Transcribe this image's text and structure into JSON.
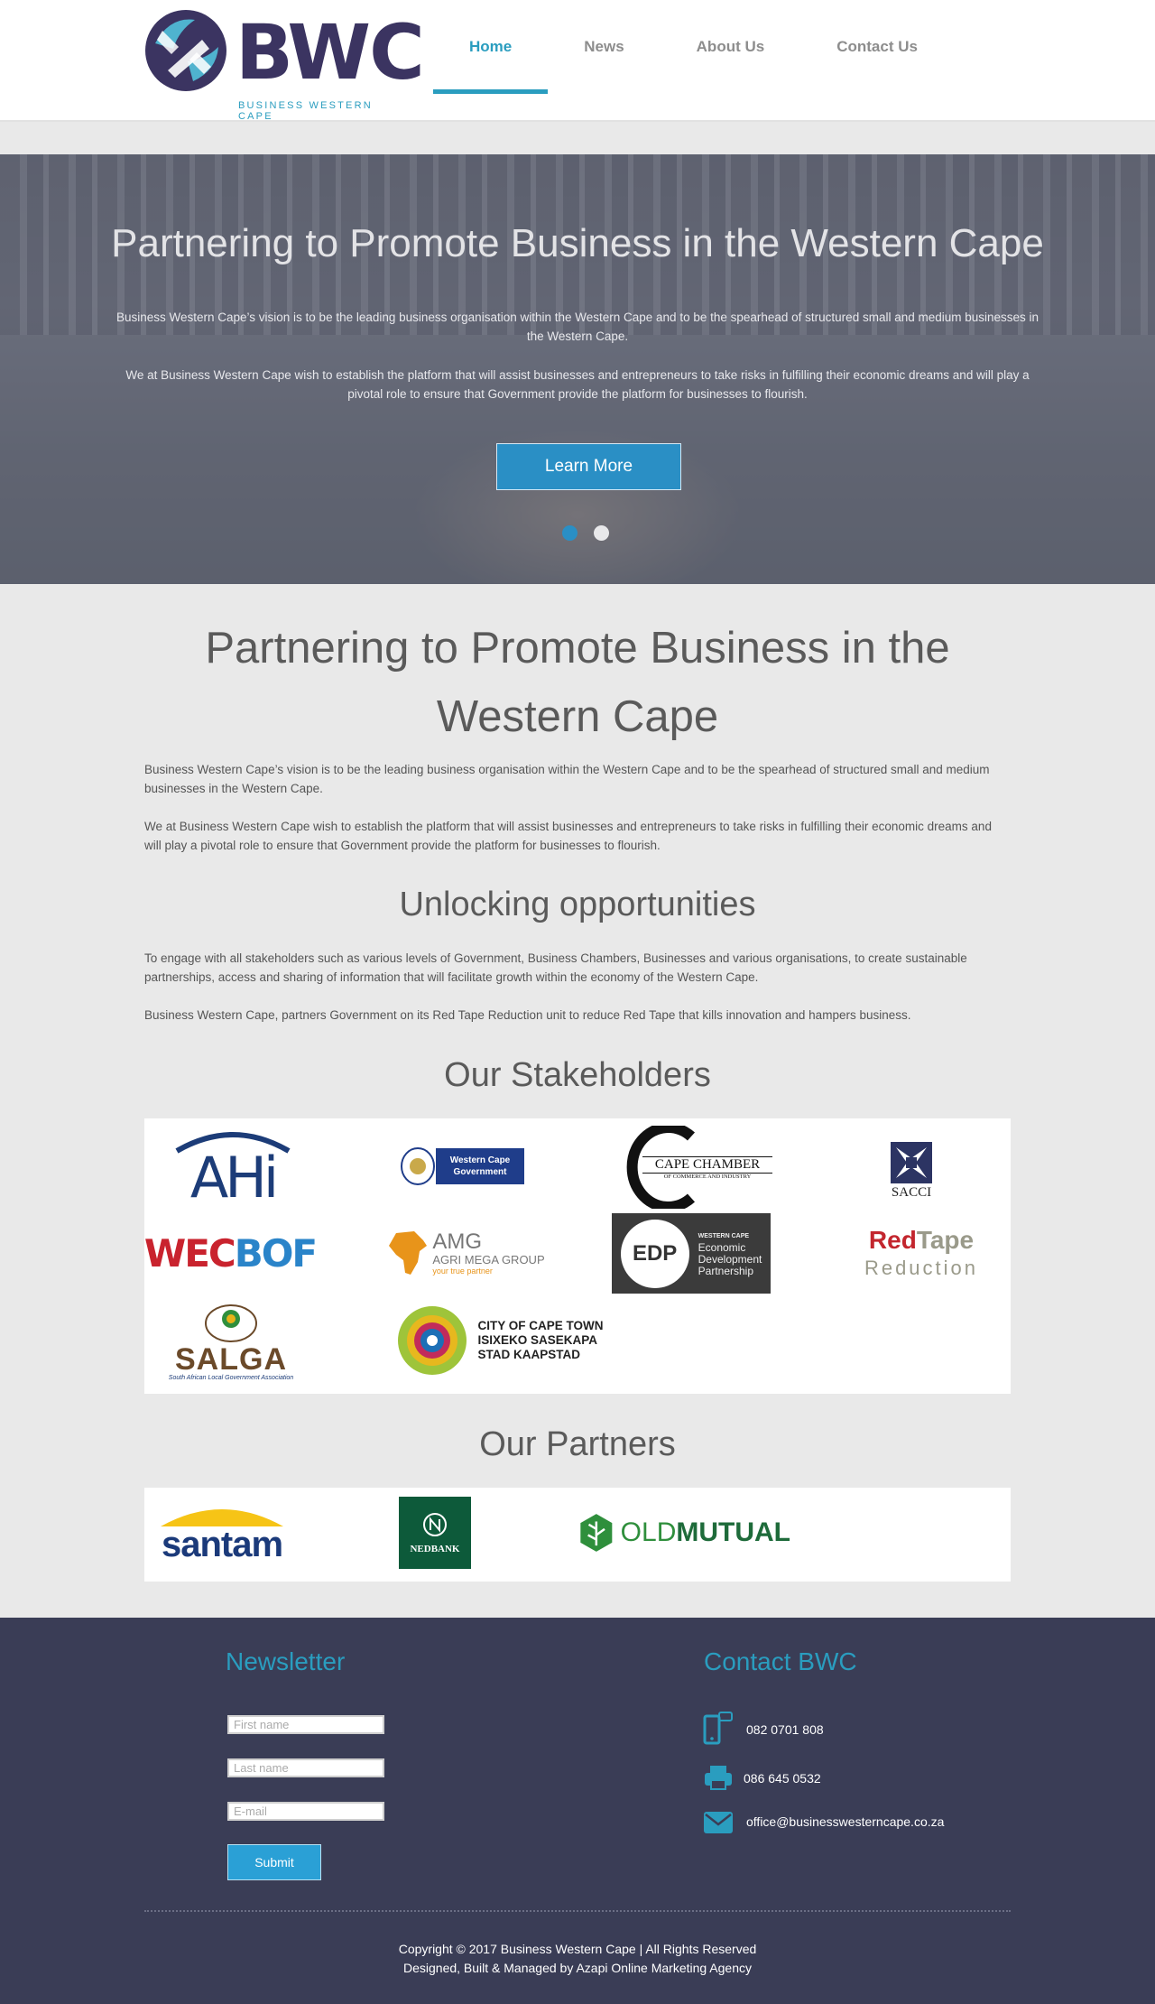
{
  "header": {
    "logo_text": "BWC",
    "logo_tagline": "BUSINESS WESTERN CAPE",
    "nav": [
      {
        "label": "Home",
        "active": true
      },
      {
        "label": "News",
        "active": false
      },
      {
        "label": "About Us",
        "active": false
      },
      {
        "label": "Contact Us",
        "active": false
      }
    ]
  },
  "hero": {
    "title": "Partnering to Promote Business in the Western Cape",
    "paragraph1": "Business Western Cape’s vision is to be the leading business organisation within the Western Cape and to be the spearhead of structured small and medium businesses in the Western Cape.",
    "paragraph2": "We at Business Western Cape wish to establish the platform that will assist businesses and entrepreneurs to take risks in fulfilling their economic dreams and will play a pivotal role to ensure that Government provide the platform for businesses to flourish.",
    "button_label": "Learn More",
    "slides": 2,
    "active_slide": 1
  },
  "intro": {
    "title": "Partnering to Promote Business in the Western Cape",
    "paragraph1": "Business Western Cape’s vision is to be the leading business organisation within the Western Cape and to be the spearhead of structured small and medium businesses in the Western Cape.",
    "paragraph2": "We at Business Western Cape wish to establish the platform that will assist businesses and entrepreneurs to take risks in fulfilling their economic dreams and will play a pivotal role to ensure that Government provide the platform for businesses to flourish."
  },
  "opportunities": {
    "title": "Unlocking opportunities",
    "paragraph1": "To engage with all stakeholders such as various levels of Government, Business Chambers, Businesses and various organisations, to create sustainable partnerships, access and sharing of information that will facilitate growth within the economy of the Western Cape.",
    "paragraph2": "Business Western Cape, partners Government on its Red Tape Reduction unit to reduce Red Tape that kills innovation and hampers business."
  },
  "stakeholders": {
    "title": "Our Stakeholders",
    "logos": {
      "ahi": "AHi",
      "wcg": "Western Cape Government",
      "cape_chamber": "CAPE CHAMBER",
      "cape_chamber_sub": "OF COMMERCE AND INDUSTRY",
      "sacci": "SACCI",
      "wecbof_a": "WEC",
      "wecbof_b": "BOF",
      "amg": "AMG",
      "amg_sub": "AGRI MEGA GROUP",
      "amg_tag": "your true partner",
      "edp": "EDP",
      "edp_l1": "WESTERN CAPE",
      "edp_l2": "Economic",
      "edp_l3": "Development",
      "edp_l4": "Partnership",
      "redtape_a": "Red",
      "redtape_b": "Tape",
      "redtape_c": "Reduction",
      "salga": "SALGA",
      "salga_sub": "South African Local Government Association",
      "cct_1": "CITY OF CAPE TOWN",
      "cct_2": "ISIXEKO SASEKAPA",
      "cct_3": "STAD KAAPSTAD"
    }
  },
  "partners": {
    "title": "Our Partners",
    "logos": {
      "santam": "santam",
      "nedbank": "NEDBANK",
      "oldmutual_a": "OLD",
      "oldmutual_b": "MUTUAL"
    }
  },
  "footer": {
    "newsletter_title": "Newsletter",
    "first_name_placeholder": "First name",
    "last_name_placeholder": "Last name",
    "email_placeholder": "E-mail",
    "submit_label": "Submit",
    "contact_title": "Contact BWC",
    "phone": "082 0701 808",
    "fax": "086 645 0532",
    "email": "office@businesswesterncape.co.za",
    "copyright": "Copyright © 2017 Business Western Cape | All Rights Reserved",
    "credits": "Designed, Built & Managed by Azapi Online Marketing Agency"
  },
  "colors": {
    "brand_purple": "#3b3461",
    "accent_blue": "#2a9dbf",
    "footer_bg": "#3a3d56",
    "button_blue": "#2a8fc5"
  }
}
